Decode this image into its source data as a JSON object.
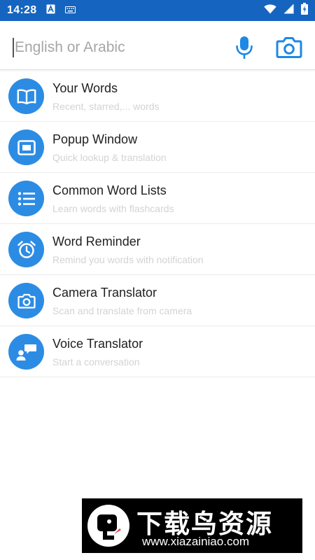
{
  "status_bar": {
    "time": "14:28",
    "background_color": "#1565c0",
    "icons": [
      "a-notification-icon",
      "keyboard-icon",
      "wifi-icon",
      "signal-icon",
      "battery-icon"
    ]
  },
  "search": {
    "placeholder": "English or Arabic",
    "value": "",
    "icons": [
      "microphone-icon",
      "camera-icon"
    ],
    "accent_color": "#1e88e5"
  },
  "menu": {
    "icon_color": "#2c8ce4",
    "items": [
      {
        "title": "Your Words",
        "subtitle": "Recent, starred,... words",
        "icon": "book-icon"
      },
      {
        "title": "Popup Window",
        "subtitle": "Quick lookup & translation",
        "icon": "popup-window-icon"
      },
      {
        "title": "Common Word Lists",
        "subtitle": "Learn words with flashcards",
        "icon": "list-icon"
      },
      {
        "title": "Word Reminder",
        "subtitle": "Remind you words with notification",
        "icon": "alarm-clock-icon"
      },
      {
        "title": "Camera Translator",
        "subtitle": "Scan and translate from camera",
        "icon": "camera-icon"
      },
      {
        "title": "Voice Translator",
        "subtitle": "Start a conversation",
        "icon": "voice-conversation-icon"
      }
    ]
  },
  "watermark": {
    "title": "下载鸟资源",
    "url": "www.xiazainiao.com"
  }
}
